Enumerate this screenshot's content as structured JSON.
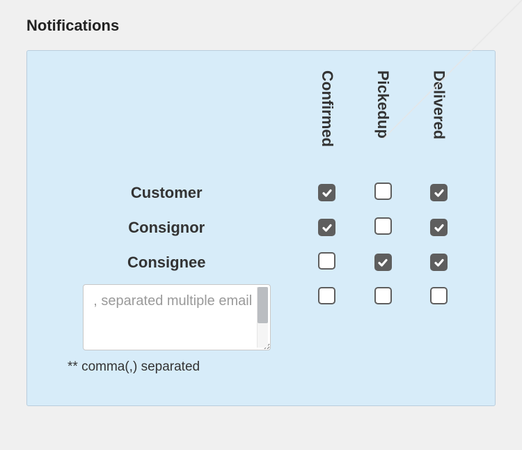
{
  "section_title": "Notifications",
  "columns": [
    "Confirmed",
    "Pickedup",
    "Delivered"
  ],
  "rows": [
    {
      "label": "Customer",
      "checks": [
        true,
        false,
        true
      ]
    },
    {
      "label": "Consignor",
      "checks": [
        true,
        false,
        true
      ]
    },
    {
      "label": "Consignee",
      "checks": [
        false,
        true,
        true
      ]
    }
  ],
  "email": {
    "placeholder": ", separated multiple email",
    "value": "",
    "hint": "** comma(,) separated",
    "checks": [
      false,
      false,
      false
    ]
  }
}
